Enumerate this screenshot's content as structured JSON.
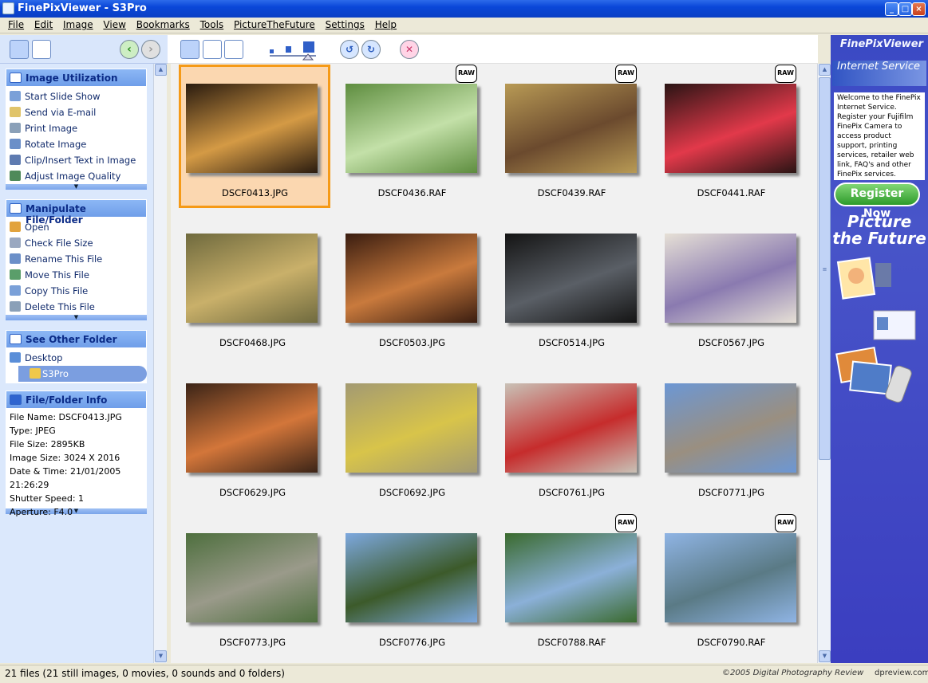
{
  "window": {
    "title": "FinePixViewer - S3Pro"
  },
  "menu": [
    "File",
    "Edit",
    "Image",
    "View",
    "Bookmarks",
    "Tools",
    "PictureTheFuture",
    "Settings",
    "Help"
  ],
  "panels": {
    "utilization": {
      "title": "Image Utilization",
      "items": [
        "Start Slide Show",
        "Send via E-mail",
        "Print Image",
        "Rotate Image",
        "Clip/Insert Text in Image",
        "Adjust Image Quality"
      ]
    },
    "manipulate": {
      "title": "Manipulate File/Folder",
      "items": [
        "Open",
        "Check File Size",
        "Rename This File",
        "Move This File",
        "Copy This File",
        "Delete This File"
      ]
    },
    "folders": {
      "title": "See Other Folder",
      "items": [
        "Desktop",
        "S3Pro"
      ]
    },
    "info": {
      "title": "File/Folder Info",
      "lines": [
        "File Name: DSCF0413.JPG",
        "Type: JPEG",
        "File Size: 2895KB",
        "Image Size: 3024 X 2016",
        "Date & Time: 21/01/2005 21:26:29",
        "Shutter Speed: 1",
        "Aperture: F4.0"
      ]
    }
  },
  "thumbnails": [
    {
      "name": "DSCF0413.JPG",
      "raw": false,
      "selected": true,
      "c1": "#2a1b0f",
      "c2": "#d49a45"
    },
    {
      "name": "DSCF0436.RAF",
      "raw": true,
      "selected": false,
      "c1": "#5e8d3f",
      "c2": "#c3e0a8"
    },
    {
      "name": "DSCF0439.RAF",
      "raw": true,
      "selected": false,
      "c1": "#b89a55",
      "c2": "#6b4a2e"
    },
    {
      "name": "DSCF0441.RAF",
      "raw": true,
      "selected": false,
      "c1": "#2a1414",
      "c2": "#e2394a"
    },
    {
      "name": "DSCF0468.JPG",
      "raw": false,
      "selected": false,
      "c1": "#6f6a3e",
      "c2": "#c9b06a"
    },
    {
      "name": "DSCF0503.JPG",
      "raw": false,
      "selected": false,
      "c1": "#3a1d10",
      "c2": "#c97a3d"
    },
    {
      "name": "DSCF0514.JPG",
      "raw": false,
      "selected": false,
      "c1": "#141414",
      "c2": "#5a5f66"
    },
    {
      "name": "DSCF0567.JPG",
      "raw": false,
      "selected": false,
      "c1": "#e6e0d6",
      "c2": "#8a7ab0"
    },
    {
      "name": "DSCF0629.JPG",
      "raw": false,
      "selected": false,
      "c1": "#3b2417",
      "c2": "#d3763a"
    },
    {
      "name": "DSCF0692.JPG",
      "raw": false,
      "selected": false,
      "c1": "#a39a72",
      "c2": "#d8c44a"
    },
    {
      "name": "DSCF0761.JPG",
      "raw": false,
      "selected": false,
      "c1": "#c9c1b6",
      "c2": "#c62c2c"
    },
    {
      "name": "DSCF0771.JPG",
      "raw": false,
      "selected": false,
      "c1": "#6c97d4",
      "c2": "#9a8f80"
    },
    {
      "name": "DSCF0773.JPG",
      "raw": false,
      "selected": false,
      "c1": "#4e6f3e",
      "c2": "#9a9a8a"
    },
    {
      "name": "DSCF0776.JPG",
      "raw": false,
      "selected": false,
      "c1": "#7da8de",
      "c2": "#3c5a2a"
    },
    {
      "name": "DSCF0788.RAF",
      "raw": true,
      "selected": false,
      "c1": "#3a6a2e",
      "c2": "#8bb0d8"
    },
    {
      "name": "DSCF0790.RAF",
      "raw": true,
      "selected": false,
      "c1": "#8fb4e4",
      "c2": "#5a7a85"
    }
  ],
  "raw_label": "RAW",
  "ad": {
    "logo": "FinePixViewer",
    "service": "Internet Service",
    "welcome": "Welcome to the FinePix Internet Service. Register your Fujifilm FinePix Camera to access product support, printing services, retailer web link, FAQ's and other FinePix services.",
    "register": "Register Now",
    "ptf": "Picture the Future"
  },
  "status": {
    "text": "21 files (21 still images, 0 movies, 0 sounds and 0 folders)",
    "copyright": "©2005 Digital Photography Review",
    "site": "dpreview.com"
  }
}
